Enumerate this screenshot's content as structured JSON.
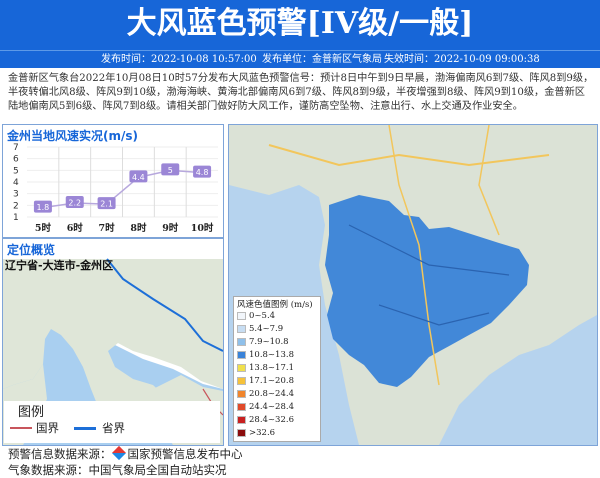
{
  "header": {
    "title": "大风蓝色预警[IV级/一般]",
    "issue_time": "发布时间：2022-10-08 10:57:00",
    "issuer": "发布单位：金普新区气象局",
    "expire_time": "失效时间：2022-10-09 09:00:38"
  },
  "description": "金普新区气象台2022年10月08日10时57分发布大风蓝色预警信号：预计8日中午到9日早晨，渤海偏南风6到7级、阵风8到9级，半夜转偏北风8级、阵风9到10级，渤海海峡、黄海北部偏南风6到7级、阵风8到9级，半夜增强到8级、阵风9到10级，金普新区陆地偏南风5到6级、阵风7到8级。请相关部门做好防大风工作，谨防高空坠物、注意出行、水上交通及作业安全。",
  "chart_panel": {
    "title": "金州当地风速实况(m/s)"
  },
  "chart_data": {
    "type": "line",
    "title": "金州当地风速实况(m/s)",
    "categories": [
      "5时",
      "6时",
      "7时",
      "8时",
      "9时",
      "10时"
    ],
    "values": [
      1.8,
      2.2,
      2.1,
      4.4,
      5,
      4.8
    ],
    "value_labels": [
      "1.8",
      "2.2",
      "2.1",
      "4.4",
      "5",
      "4.8"
    ],
    "y_ticks": [
      "1",
      "2",
      "3",
      "4",
      "5",
      "6",
      "7"
    ],
    "ylim": [
      1,
      7
    ],
    "line_color": "#b7a8dd",
    "marker_color": "#9b86d6"
  },
  "location_panel": {
    "title": "定位概览",
    "region": "辽宁省-大连市-金州区"
  },
  "small_legend": {
    "title": "图例",
    "items": [
      {
        "label": "国界",
        "color": "#c8555c"
      },
      {
        "label": "省界",
        "color": "#1d6fd8"
      }
    ]
  },
  "wind_legend": {
    "title": "风速色值图例 (m/s)",
    "items": [
      {
        "label": "0~5.4",
        "color": "#f2f6fb"
      },
      {
        "label": "5.4~7.9",
        "color": "#c7ddf2"
      },
      {
        "label": "7.9~10.8",
        "color": "#8fc0ea"
      },
      {
        "label": "10.8~13.8",
        "color": "#3a83d8"
      },
      {
        "label": "13.8~17.1",
        "color": "#f0e04c"
      },
      {
        "label": "17.1~20.8",
        "color": "#f6c23a"
      },
      {
        "label": "20.8~24.4",
        "color": "#f0852c"
      },
      {
        "label": "24.4~28.4",
        "color": "#e04a2a"
      },
      {
        "label": "28.4~32.6",
        "color": "#c82020"
      },
      {
        "label": ">32.6",
        "color": "#8a0c0c"
      }
    ]
  },
  "footer": {
    "source_label": "预警信息数据来源：",
    "source_value": "国家预警信息发布中心",
    "data_source": "气象数据来源：中国气象局全国自动站实况"
  }
}
